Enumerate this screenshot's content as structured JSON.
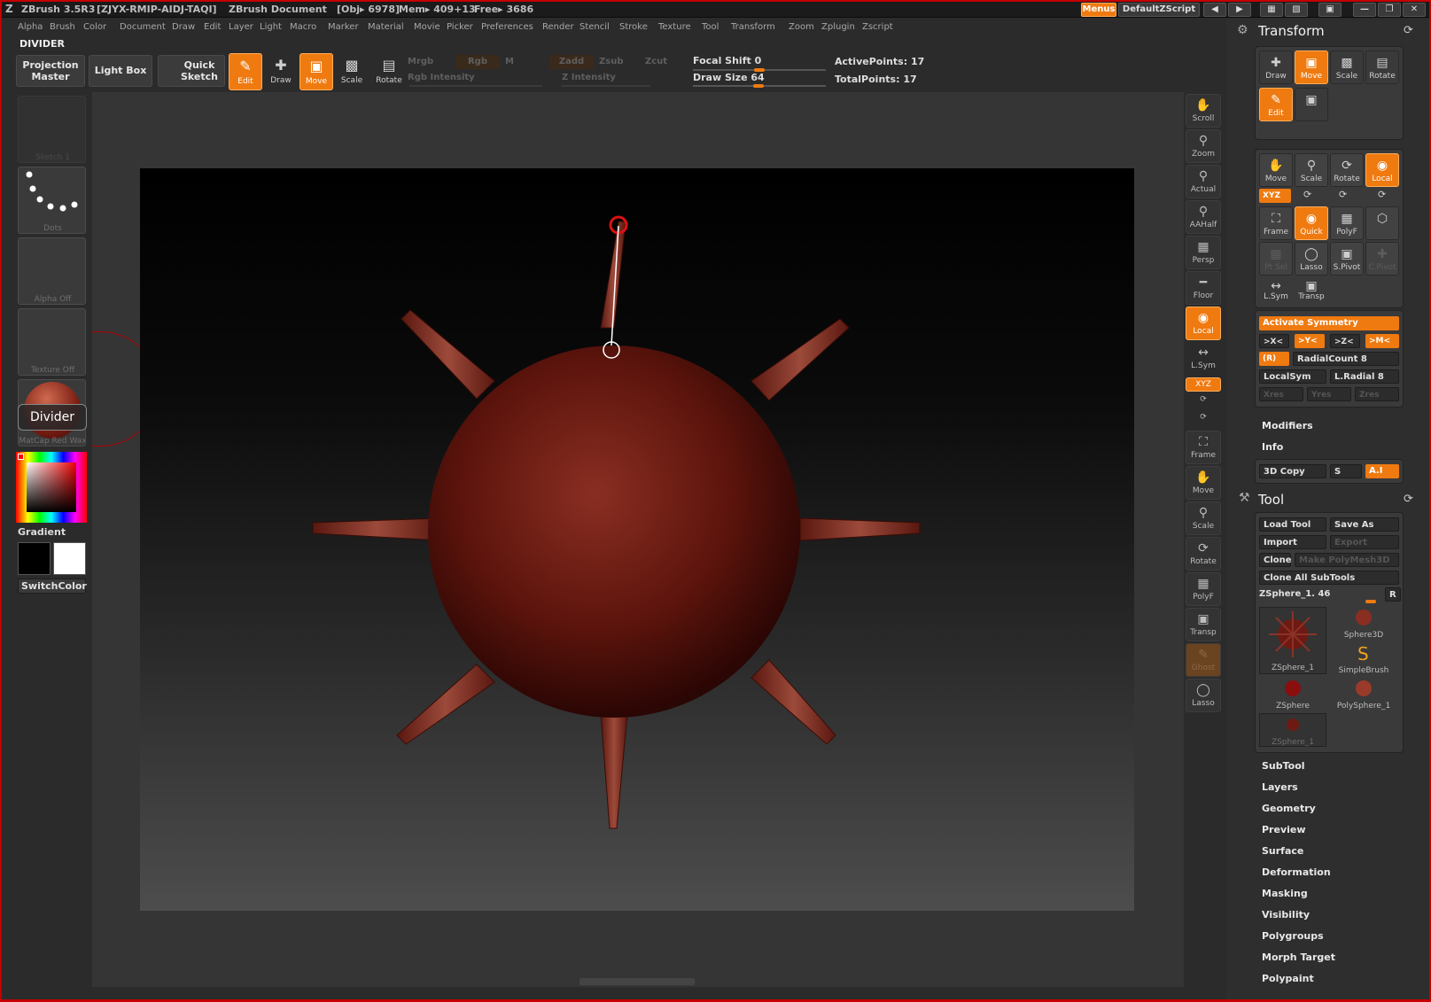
{
  "window": {
    "app": "ZBrush 3.5R3",
    "id": "[ZJYX-RMIP-AIDJ-TAQI]",
    "document": "ZBrush Document",
    "obj": "[Obj▸ 6978]",
    "mem": "Mem▸ 409+13",
    "free": "Free▸ 3686",
    "menus_btn": "Menus",
    "script_btn": "DefaultZScript"
  },
  "menu": [
    "Alpha",
    "Brush",
    "Color",
    "Document",
    "Draw",
    "Edit",
    "Layer",
    "Light",
    "Macro",
    "Marker",
    "Material",
    "Movie",
    "Picker",
    "Preferences",
    "Render",
    "Stencil",
    "Stroke",
    "Texture",
    "Tool",
    "Transform",
    "Zoom",
    "Zplugin",
    "Zscript"
  ],
  "current_tool_label": "DIVIDER",
  "toolbar": {
    "projection_master": "Projection Master",
    "light_box": "Light Box",
    "quick_sketch": "Quick Sketch",
    "edit": "Edit",
    "draw": "Draw",
    "move": "Move",
    "scale": "Scale",
    "rotate": "Rotate",
    "mrgb": "Mrgb",
    "rgb": "Rgb",
    "m": "M",
    "zadd": "Zadd",
    "zsub": "Zsub",
    "zcut": "Zcut",
    "rgb_intensity": "Rgb Intensity",
    "z_intensity": "Z Intensity",
    "focal_shift_label": "Focal Shift",
    "focal_shift_value": "0",
    "draw_size_label": "Draw Size",
    "draw_size_value": "64",
    "active_points_label": "ActivePoints:",
    "active_points_value": "17",
    "total_points_label": "TotalPoints:",
    "total_points_value": "17"
  },
  "left": {
    "sketch": "Sketch 1",
    "dots": "Dots",
    "alpha": "Alpha Off",
    "texture": "Texture Off",
    "matcap": "MatCap Red Wax",
    "tooltip": "Divider",
    "gradient": "Gradient",
    "switchcolor": "SwitchColor"
  },
  "right_strip": [
    "Scroll",
    "Zoom",
    "Actual",
    "AAHalf",
    "Persp",
    "Floor",
    "Local",
    "L.Sym",
    "XYZ",
    "Frame",
    "Move",
    "Scale",
    "Rotate",
    "PolyF",
    "Transp",
    "Ghost",
    "Lasso"
  ],
  "transform": {
    "title": "Transform",
    "row1": [
      "Draw",
      "Move",
      "Scale",
      "Rotate"
    ],
    "edit": "Edit",
    "row2": [
      "Move",
      "Scale",
      "Rotate",
      "Local"
    ],
    "xyz": "XYZ",
    "row3": [
      "Frame",
      "Quick",
      "PolyF"
    ],
    "row4": [
      "Pt Sel",
      "Lasso",
      "S.Pivot",
      "C.Pivot"
    ],
    "row5": [
      "L.Sym",
      "Transp"
    ],
    "activate_symmetry": "Activate Symmetry",
    "axes": [
      ">X<",
      ">Y<",
      ">Z<",
      ">M<"
    ],
    "r": "(R)",
    "radial_count": "RadialCount 8",
    "local_sym": "LocalSym",
    "l_radial": "L.Radial 8",
    "res": [
      "Xres",
      "Yres",
      "Zres"
    ],
    "modifiers": "Modifiers",
    "info": "Info",
    "copy3d": "3D Copy",
    "s": "S",
    "ai": "A.I"
  },
  "tool": {
    "title": "Tool",
    "load": "Load Tool",
    "save": "Save As",
    "import": "Import",
    "export": "Export",
    "clone": "Clone",
    "make_poly": "Make PolyMesh3D",
    "clone_all": "Clone All SubTools",
    "current": "ZSphere_1. 46",
    "r": "R",
    "thumbs": [
      "ZSphere_1",
      "Sphere3D",
      "SimpleBrush",
      "ZSphere",
      "PolySphere_1",
      "ZSphere_1"
    ],
    "sections": [
      "SubTool",
      "Layers",
      "Geometry",
      "Preview",
      "Surface",
      "Deformation",
      "Masking",
      "Visibility",
      "Polygroups",
      "Morph Target",
      "Polypaint"
    ]
  },
  "colors": {
    "accent": "#ef7a10",
    "frame": "#c40000",
    "sphere": "#6e1a12",
    "spike": "#8a3226"
  }
}
